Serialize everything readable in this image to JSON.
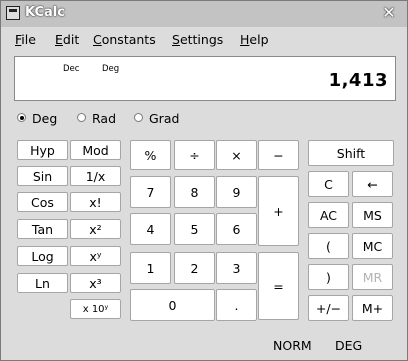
{
  "window": {
    "title": "KCalc",
    "close_glyph": "✕"
  },
  "menubar": {
    "items": [
      "File",
      "Edit",
      "Constants",
      "Settings",
      "Help"
    ]
  },
  "display": {
    "base_label": "Dec",
    "angle_label": "Deg",
    "value": "1,413"
  },
  "angle_mode": {
    "options": [
      "Deg",
      "Rad",
      "Grad"
    ],
    "selected": "Deg"
  },
  "function_buttons": [
    "Hyp",
    "Mod",
    "Sin",
    "1/x",
    "Cos",
    "x!",
    "Tan",
    "x²",
    "Log",
    "xʸ",
    "Ln",
    "x³",
    "x 10ʸ"
  ],
  "numpad_buttons": [
    "%",
    "÷",
    "×",
    "−",
    "7",
    "8",
    "9",
    "+",
    "4",
    "5",
    "6",
    "1",
    "2",
    "3",
    "=",
    "0",
    "."
  ],
  "memory_buttons": [
    "Shift",
    "C",
    "←",
    "AC",
    "MS",
    "(",
    "MC",
    ")",
    "MR",
    "+/−",
    "M+"
  ],
  "status": {
    "mode": "NORM",
    "angle": "DEG"
  },
  "colors": {
    "button_bg": "#ffffff",
    "button_border": "#a6a6a6",
    "disabled_text": "#b4b4b4"
  }
}
